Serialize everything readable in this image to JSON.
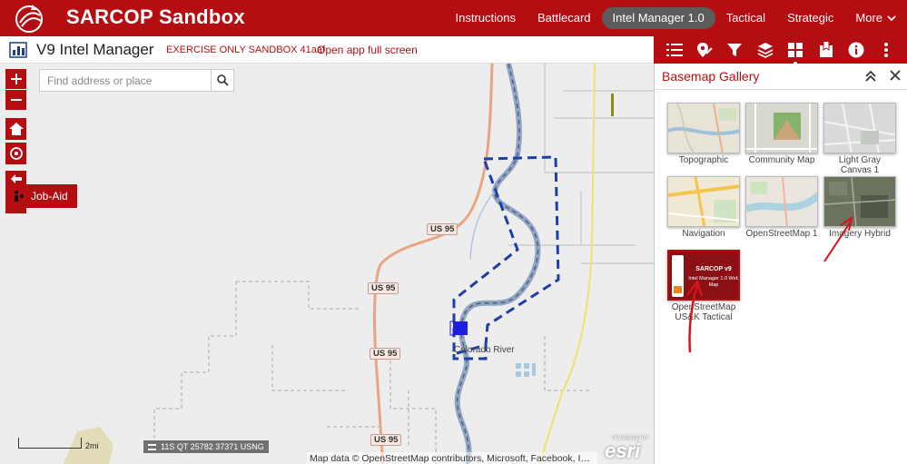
{
  "header": {
    "app_title": "SARCOP Sandbox",
    "nav": [
      "Instructions",
      "Battlecard",
      "Intel Manager 1.0",
      "Tactical",
      "Strategic",
      "More"
    ]
  },
  "subbar": {
    "module_title": "V9 Intel Manager",
    "exercise": "EXERCISE ONLY SANDBOX 41aaf",
    "fullscreen": "Open app full screen"
  },
  "toolbar": {
    "tools": [
      "list-icon",
      "location-edit-icon",
      "filter-icon",
      "layers-icon",
      "basemap-gallery-icon",
      "bookmark-icon",
      "info-icon",
      "more-vertical-icon"
    ],
    "active": "basemap-gallery-icon"
  },
  "map": {
    "search_placeholder": "Find address or place",
    "job_aid": "Job-Aid",
    "coords": "11S QT 25782 37371 USNG",
    "scale": "2mi",
    "attribution": "Map data © OpenStreetMap contributors, Microsoft, Facebook, Inc...",
    "esri_powered": "POWERED BY",
    "esri": "esri",
    "place_label": "Colorado River",
    "route_labels": [
      "US 95",
      "US 95",
      "US 95",
      "US 95"
    ]
  },
  "panel": {
    "title": "Basemap Gallery",
    "tiles": [
      {
        "label": "Topographic"
      },
      {
        "label": "Community Map"
      },
      {
        "label": "Light Gray Canvas 1"
      },
      {
        "label": "Navigation"
      },
      {
        "label": "OpenStreetMap 1"
      },
      {
        "label": "Imagery Hybrid"
      },
      {
        "label": "OpenStreetMap US&K Tactical",
        "thumb_title": "SARCOP v9",
        "thumb_sub": "Intel Manager 1.0 Web Map"
      }
    ]
  },
  "colors": {
    "brand_red": "#b50e12",
    "active_nav": "#5c5c5c",
    "aoi_blue": "#1f3fa8",
    "annotation_red": "#d4141a"
  }
}
